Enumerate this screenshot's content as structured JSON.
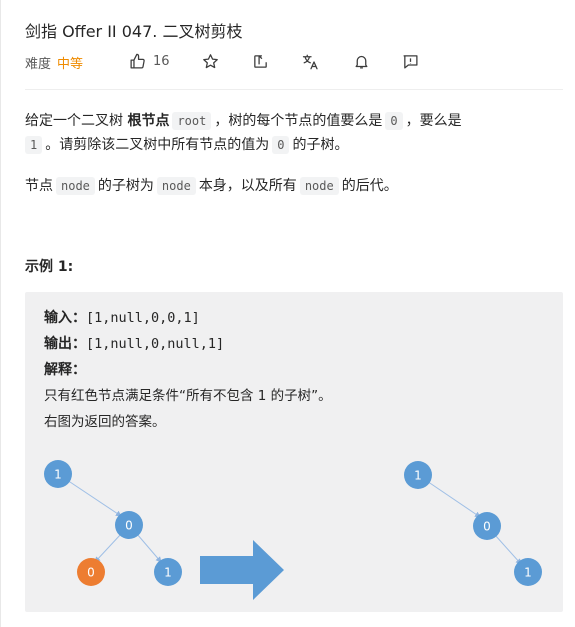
{
  "header": {
    "title": "剑指 Offer II 047. 二叉树剪枝",
    "difficulty_label": "难度",
    "difficulty_value": "中等",
    "likes": "16"
  },
  "icons": [
    "thumbs-up-icon",
    "star-icon",
    "share-icon",
    "translate-icon",
    "bell-icon",
    "feedback-icon"
  ],
  "description": {
    "p1_a": "给定一个二叉树 ",
    "p1_bold": "根节点",
    "p1_code_root": "root",
    "p1_b": "，树的每个节点的值要么是",
    "p1_code_0": "0",
    "p1_c": "，要么是",
    "p1_code_1": "1",
    "p1_d": "。请剪除该二叉树中所有节点的值为",
    "p1_code_0b": "0",
    "p1_e": "的子树。",
    "p2_a": "节点",
    "p2_code_node": "node",
    "p2_b": "的子树为",
    "p2_code_node2": "node",
    "p2_c": "本身，以及所有",
    "p2_code_node3": "node",
    "p2_d": "的后代。"
  },
  "example": {
    "title": "示例 1:",
    "input_label": "输入：",
    "input_value": "[1,null,0,0,1]",
    "output_label": "输出：",
    "output_value": "[1,null,0,null,1]",
    "explain_label": "解释：",
    "explain_line1": "只有红色节点满足条件“所有不包含 1 的子树”。",
    "explain_line2": "右图为返回的答案。"
  },
  "trees": {
    "before": [
      "1",
      "0",
      "0",
      "1"
    ],
    "after": [
      "1",
      "0",
      "1"
    ],
    "node_color": "#5b9bd5",
    "removed_color": "#ed7d31",
    "arrow_color": "#5b9bd5"
  }
}
